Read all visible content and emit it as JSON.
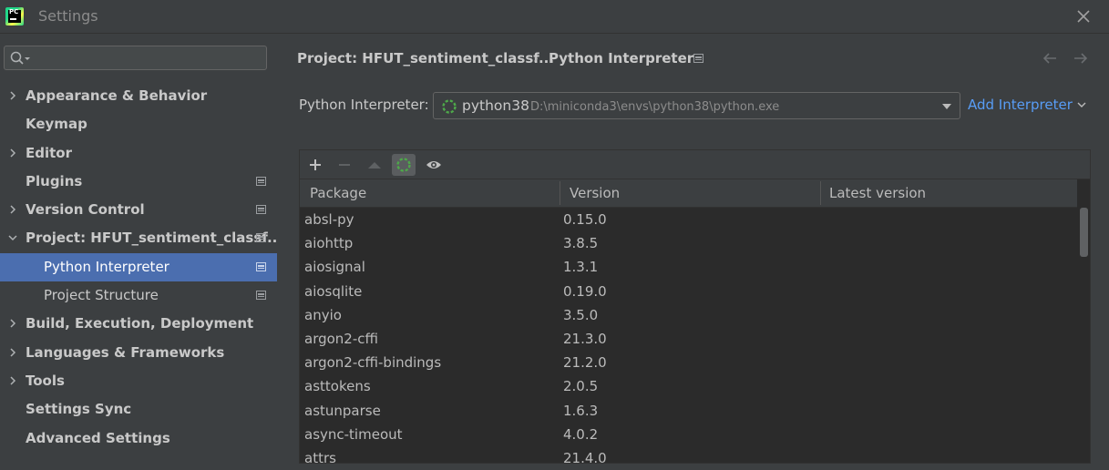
{
  "window": {
    "title": "Settings",
    "logo_text": "PC"
  },
  "sidebar": {
    "search_placeholder": "",
    "items": [
      {
        "label": "Appearance & Behavior",
        "expandable": true,
        "expanded": false,
        "scope_icon": false
      },
      {
        "label": "Keymap",
        "expandable": false,
        "scope_icon": false
      },
      {
        "label": "Editor",
        "expandable": true,
        "expanded": false,
        "scope_icon": false
      },
      {
        "label": "Plugins",
        "expandable": false,
        "scope_icon": true
      },
      {
        "label": "Version Control",
        "expandable": true,
        "expanded": false,
        "scope_icon": true
      },
      {
        "label": "Project: HFUT_sentiment_classf...",
        "expandable": true,
        "expanded": true,
        "scope_icon": true
      },
      {
        "label": "Python Interpreter",
        "child": true,
        "selected": true,
        "scope_icon": true
      },
      {
        "label": "Project Structure",
        "child": true,
        "scope_icon": true
      },
      {
        "label": "Build, Execution, Deployment",
        "expandable": true,
        "expanded": false,
        "scope_icon": false
      },
      {
        "label": "Languages & Frameworks",
        "expandable": true,
        "expanded": false,
        "scope_icon": false
      },
      {
        "label": "Tools",
        "expandable": true,
        "expanded": false,
        "scope_icon": false
      },
      {
        "label": "Settings Sync",
        "expandable": false,
        "scope_icon": false
      },
      {
        "label": "Advanced Settings",
        "expandable": false,
        "scope_icon": false
      }
    ]
  },
  "breadcrumb": {
    "project": "Project: HFUT_sentiment_classf...",
    "separator": "›",
    "page": "Python Interpreter"
  },
  "interpreter": {
    "label": "Python Interpreter:",
    "name": "python38",
    "path": "D:\\miniconda3\\envs\\python38\\python.exe",
    "add_label": "Add Interpreter"
  },
  "toolbar": {
    "buttons": [
      "plus-icon",
      "minus-icon",
      "upgrade-icon",
      "loading-icon",
      "eye-icon"
    ]
  },
  "packages": {
    "columns": [
      "Package",
      "Version",
      "Latest version"
    ],
    "rows": [
      {
        "name": "absl-py",
        "version": "0.15.0",
        "latest": ""
      },
      {
        "name": "aiohttp",
        "version": "3.8.5",
        "latest": ""
      },
      {
        "name": "aiosignal",
        "version": "1.3.1",
        "latest": ""
      },
      {
        "name": "aiosqlite",
        "version": "0.19.0",
        "latest": ""
      },
      {
        "name": "anyio",
        "version": "3.5.0",
        "latest": ""
      },
      {
        "name": "argon2-cffi",
        "version": "21.3.0",
        "latest": ""
      },
      {
        "name": "argon2-cffi-bindings",
        "version": "21.2.0",
        "latest": ""
      },
      {
        "name": "asttokens",
        "version": "2.0.5",
        "latest": ""
      },
      {
        "name": "astunparse",
        "version": "1.6.3",
        "latest": ""
      },
      {
        "name": "async-timeout",
        "version": "4.0.2",
        "latest": ""
      },
      {
        "name": "attrs",
        "version": "21.4.0",
        "latest": ""
      }
    ]
  },
  "colors": {
    "background": "#3c3f41",
    "table_background": "#2b2b2b",
    "selection": "#4b6eaf",
    "link": "#589df6",
    "spinner": "#4ea84a"
  }
}
